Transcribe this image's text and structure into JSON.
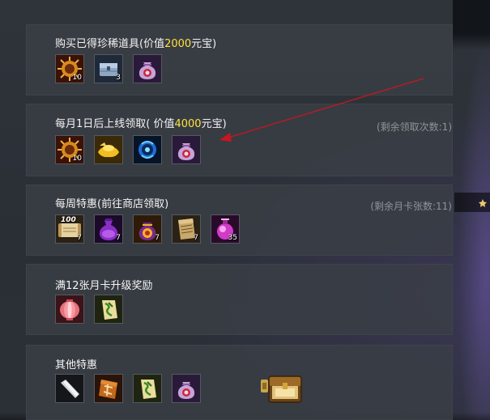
{
  "sections": [
    {
      "title_prefix": "购买已得珍稀道具(价值",
      "title_value": "2000",
      "title_suffix": "元宝)",
      "items": [
        {
          "icon": "sun-emblem-icon",
          "count": "10"
        },
        {
          "icon": "silver-chest-icon",
          "count": "3"
        },
        {
          "icon": "money-bag-icon",
          "count": ""
        }
      ]
    },
    {
      "title_prefix": "每月1日后上线领取(  价值",
      "title_value": "4000",
      "title_suffix": "元宝)",
      "note": "(剩余领取次数:1)",
      "items": [
        {
          "icon": "sun-emblem-icon",
          "count": "10"
        },
        {
          "icon": "gold-ingot-icon",
          "count": ""
        },
        {
          "icon": "blue-orb-icon",
          "count": ""
        },
        {
          "icon": "money-bag-icon",
          "count": ""
        }
      ]
    },
    {
      "title": "每周特惠(前往商店领取)",
      "note": "(剩余月卡张数:11)",
      "items": [
        {
          "icon": "scroll-100-icon",
          "count": "7",
          "top_count": "100"
        },
        {
          "icon": "purple-potion-icon",
          "count": "7"
        },
        {
          "icon": "gold-pouch-icon",
          "count": "7"
        },
        {
          "icon": "paper-scroll-icon",
          "count": "7"
        },
        {
          "icon": "pink-potion-icon",
          "count": "35"
        }
      ]
    },
    {
      "title": "满12张月卡升级奖励",
      "items": [
        {
          "icon": "red-lantern-icon",
          "count": ""
        },
        {
          "icon": "talisman-icon",
          "count": ""
        }
      ]
    },
    {
      "title": "其他特惠",
      "items": [
        {
          "icon": "silver-blade-icon",
          "count": ""
        },
        {
          "icon": "fortune-tile-icon",
          "count": ""
        },
        {
          "icon": "talisman-icon",
          "count": ""
        },
        {
          "icon": "money-bag-icon",
          "count": ""
        }
      ]
    }
  ],
  "extras": {
    "chest_icon": "treasure-chest-icon",
    "arrow_color": "#c8161d"
  }
}
